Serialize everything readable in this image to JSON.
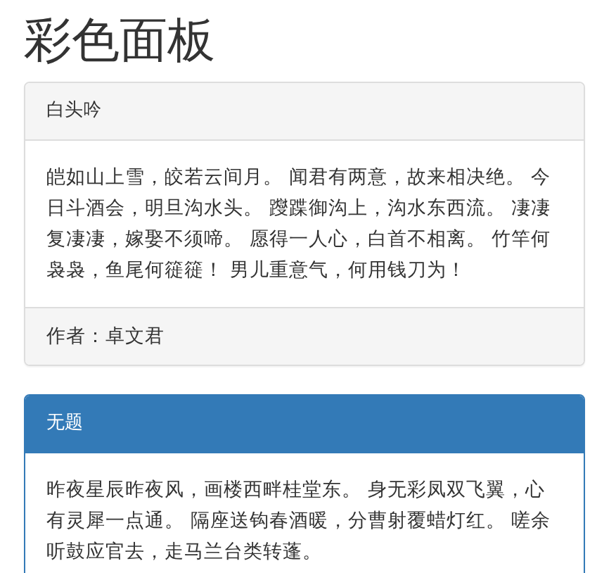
{
  "page_title": "彩色面板",
  "panels": [
    {
      "kind": "default",
      "heading": "白头吟",
      "body": "皑如山上雪，皎若云间月。 闻君有两意，故来相决绝。 今日斗酒会，明旦沟水头。 躞蹀御沟上，沟水东西流。 凄凄复凄凄，嫁娶不须啼。 愿得一人心，白首不相离。 竹竿何袅袅，鱼尾何簁簁！ 男儿重意气，何用钱刀为！",
      "footer": "作者：卓文君"
    },
    {
      "kind": "primary",
      "heading": "无题",
      "body": "昨夜星辰昨夜风，画楼西畔桂堂东。 身无彩凤双飞翼，心有灵犀一点通。 隔座送钩春酒暖，分曹射覆蜡灯红。 嗟余听鼓应官去，走马兰台类转蓬。"
    }
  ]
}
